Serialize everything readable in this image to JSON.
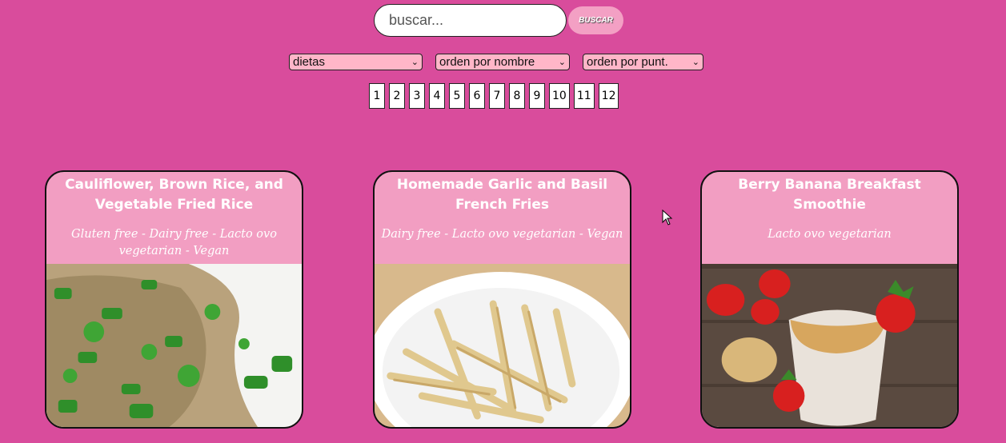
{
  "search": {
    "placeholder": "buscar...",
    "button_label": "BUSCAR"
  },
  "filters": {
    "diets": "dietas",
    "order_name": "orden por nombre",
    "order_score": "orden por punt."
  },
  "pagination": {
    "pages": [
      "1",
      "2",
      "3",
      "4",
      "5",
      "6",
      "7",
      "8",
      "9",
      "10",
      "11",
      "12"
    ]
  },
  "recipes": [
    {
      "title": "Cauliflower, Brown Rice, and Vegetable Fried Rice",
      "diets": "Gluten free - Dairy free - Lacto ovo vegetarian - Vegan"
    },
    {
      "title": "Homemade Garlic and Basil French Fries",
      "diets": "Dairy free - Lacto ovo vegetarian - Vegan"
    },
    {
      "title": "Berry Banana Breakfast Smoothie",
      "diets": "Lacto ovo vegetarian"
    }
  ],
  "colors": {
    "background": "#d94c9c",
    "card": "#f29ec2",
    "select": "#ffb6c8",
    "button": "#f3a0c4"
  }
}
